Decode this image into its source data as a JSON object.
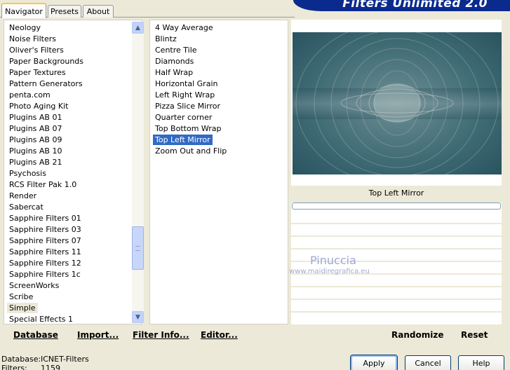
{
  "tabs": [
    "Navigator",
    "Presets",
    "About"
  ],
  "banner": {
    "title": "Filters Unlimited 2.0",
    "color": "#0A2A8E"
  },
  "categories": {
    "items": [
      "Neology",
      "Noise Filters",
      "Oliver's Filters",
      "Paper Backgrounds",
      "Paper Textures",
      "Pattern Generators",
      "penta.com",
      "Photo Aging Kit",
      "Plugins AB 01",
      "Plugins AB 07",
      "Plugins AB 09",
      "Plugins AB 10",
      "Plugins AB 21",
      "Psychosis",
      "RCS Filter Pak 1.0",
      "Render",
      "Sabercat",
      "Sapphire Filters 01",
      "Sapphire Filters 03",
      "Sapphire Filters 07",
      "Sapphire Filters 11",
      "Sapphire Filters 12",
      "Sapphire Filters 1c",
      "ScreenWorks",
      "Scribe",
      "Simple",
      "Special Effects 1"
    ],
    "selected": "Simple",
    "scrollbar_up_icon": "arrow-up-icon",
    "scrollbar_down_icon": "arrow-down-icon"
  },
  "filters": {
    "items": [
      "4 Way Average",
      "Blintz",
      "Centre Tile",
      "Diamonds",
      "Half Wrap",
      "Horizontal Grain",
      "Left Right Wrap",
      "Pizza Slice Mirror",
      "Quarter corner",
      "Top Bottom Wrap",
      "Top Left Mirror",
      "Zoom Out and Flip"
    ],
    "selected": "Top Left Mirror",
    "selection_color": "#316AC5"
  },
  "preview": {
    "filter_name": "Top Left Mirror",
    "watermark_name": "Pinuccia",
    "watermark_url": "www.maidiregrafica.eu"
  },
  "actions": {
    "database": "Database",
    "import": "Import...",
    "filter_info": "Filter Info...",
    "editor": "Editor...",
    "randomize": "Randomize",
    "reset": "Reset"
  },
  "status": {
    "database_label": "Database:",
    "database_value": "ICNET-Filters",
    "filters_label": "Filters:",
    "filters_value": "1159"
  },
  "buttons": {
    "apply": "Apply",
    "cancel": "Cancel",
    "help": "Help"
  }
}
